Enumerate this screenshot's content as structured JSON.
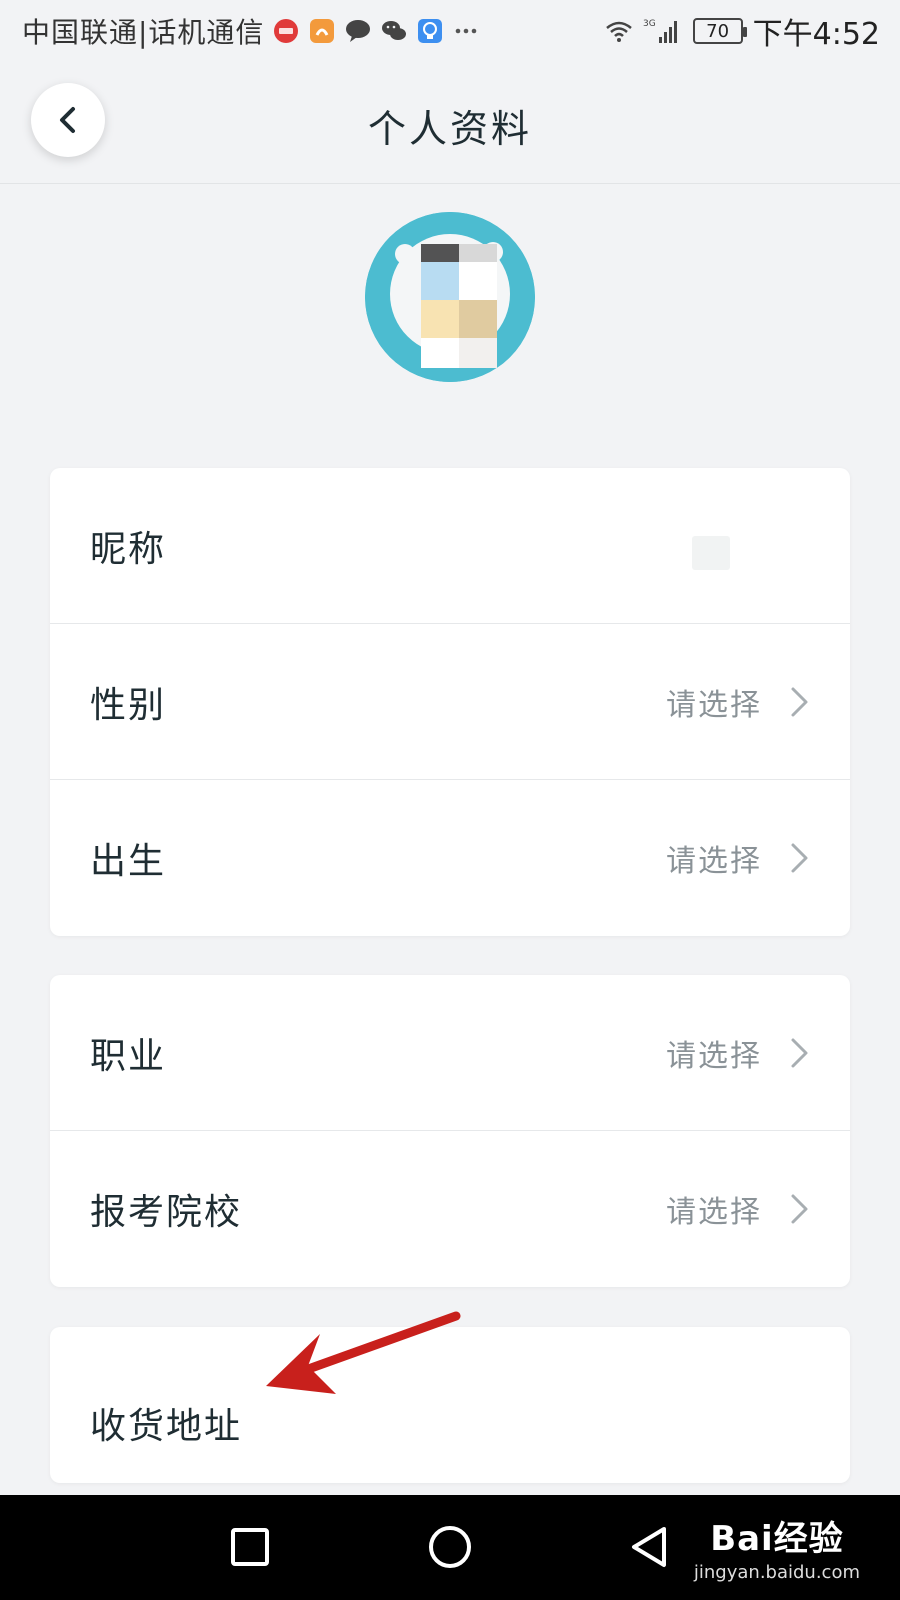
{
  "status_bar": {
    "carrier": "中国联通|话机通信",
    "time": "下午4:52",
    "battery": "70",
    "network": "3G",
    "icons": [
      "app-badge-icon",
      "uc-browser-icon",
      "message-icon",
      "wechat-icon",
      "bulb-icon",
      "more-icon",
      "wifi-icon",
      "signal-icon"
    ]
  },
  "header": {
    "title": "个人资料",
    "back_icon": "chevron-left-icon"
  },
  "profile_groups": [
    {
      "rows": [
        {
          "label": "昵称",
          "value": ""
        },
        {
          "label": "性别",
          "value": "请选择"
        },
        {
          "label": "出生",
          "value": "请选择"
        }
      ]
    },
    {
      "rows": [
        {
          "label": "职业",
          "value": "请选择"
        },
        {
          "label": "报考院校",
          "value": "请选择"
        }
      ]
    },
    {
      "rows": [
        {
          "label": "收货地址",
          "value": ""
        }
      ]
    }
  ],
  "annotation": {
    "color": "#c8201c"
  },
  "nav_bar": {
    "icons": [
      "recent-apps-icon",
      "home-icon",
      "back-triangle-icon"
    ]
  },
  "watermark": {
    "logo": "Bai经验",
    "url": "jingyan.baidu.com"
  }
}
